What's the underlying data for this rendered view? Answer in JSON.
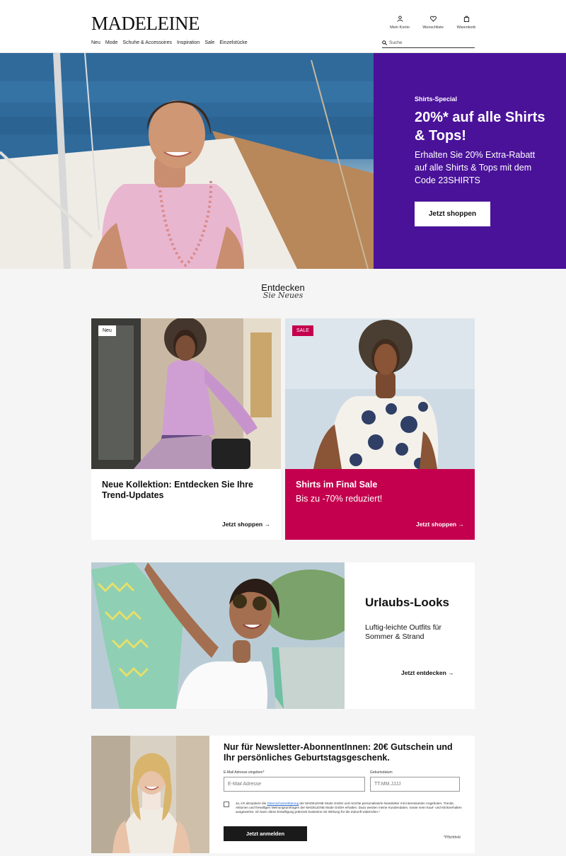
{
  "header": {
    "logo": "MADELEINE",
    "icons": [
      {
        "label": "Mein Konto",
        "icon": "user-icon"
      },
      {
        "label": "Wunschliste",
        "icon": "heart-icon"
      },
      {
        "label": "Warenkorb",
        "icon": "bag-icon"
      }
    ],
    "nav": [
      "Neu",
      "Mode",
      "Schuhe & Accessoires",
      "Inspiration",
      "Sale",
      "Einzelstücke"
    ],
    "search_placeholder": "Suche"
  },
  "hero": {
    "eyebrow": "Shirts-Special",
    "title": "20%* auf alle Shirts & Tops!",
    "text": "Erhalten Sie 20% Extra-Rabatt auf alle Shirts & Tops mit dem Code 23SHIRTS",
    "button": "Jetzt shoppen",
    "panel_color": "#4a1299"
  },
  "discover": {
    "title": "Entdecken",
    "script": "Sie Neues"
  },
  "cards": [
    {
      "badge": "Neu",
      "title": "Neue Kollektion: Entdecken Sie Ihre Trend-Updates",
      "sub": "",
      "link": "Jetzt shoppen"
    },
    {
      "badge": "SALE",
      "title": "Shirts im Final Sale",
      "sub": "Bis zu -70% reduziert!",
      "link": "Jetzt shoppen",
      "color": "#c4004e"
    }
  ],
  "urlaub": {
    "title": "Urlaubs-Looks",
    "text": "Luftig-leichte Outfits für Sommer & Strand",
    "link": "Jetzt entdecken"
  },
  "newsletter": {
    "title": "Nur für Newsletter-AbonnentInnen: 20€ Gutschein und Ihr persönliches Geburtstagsgeschenk.",
    "email_label": "E-Mail Adresse eingeben*",
    "email_placeholder": "E-Mail Adresse",
    "birthday_label": "Geburtsdatum",
    "birthday_placeholder": "TT.MM.JJJJ",
    "legal_pre": "Ja, ich akzeptiere die",
    "legal_link": "Datenschutzerklärung",
    "legal_post": "der MADELEINE Mode GmbH und möchte personalisierte Newsletter mit interessanten Angeboten, Trends, Aktionen und freiwilligen Meinungsumfragen der MADELEINE Mode GmbH erhalten. Dazu werden meine Kundendaten, sowie mein Kauf- und Klickverhalten ausgewertet. Ich kann diese Einwilligung jederzeit kostenlos mit Wirkung für die Zukunft widerrufen.*",
    "button": "Jetzt anmelden",
    "required": "*Pflichtfeld"
  }
}
